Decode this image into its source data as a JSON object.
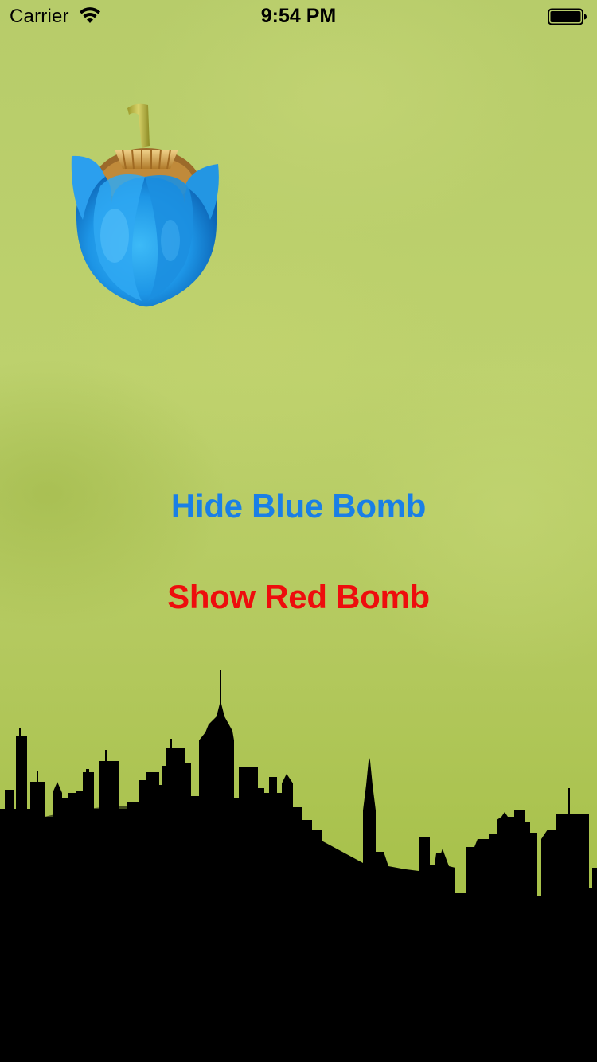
{
  "status_bar": {
    "carrier": "Carrier",
    "time": "9:54 PM",
    "wifi_icon": "wifi-icon",
    "battery_icon": "battery-full-icon"
  },
  "game": {
    "bomb_icon": "blue-bomb-icon",
    "skyline": "city-skyline-silhouette"
  },
  "buttons": {
    "hide_blue_bomb": "Hide Blue Bomb",
    "show_red_bomb": "Show Red Bomb"
  },
  "colors": {
    "hide_button": "#1a7fe6",
    "show_button": "#ee0d0d",
    "background": "#b7cc6a",
    "skyline": "#000000",
    "bomb": "#2ea6ee"
  }
}
